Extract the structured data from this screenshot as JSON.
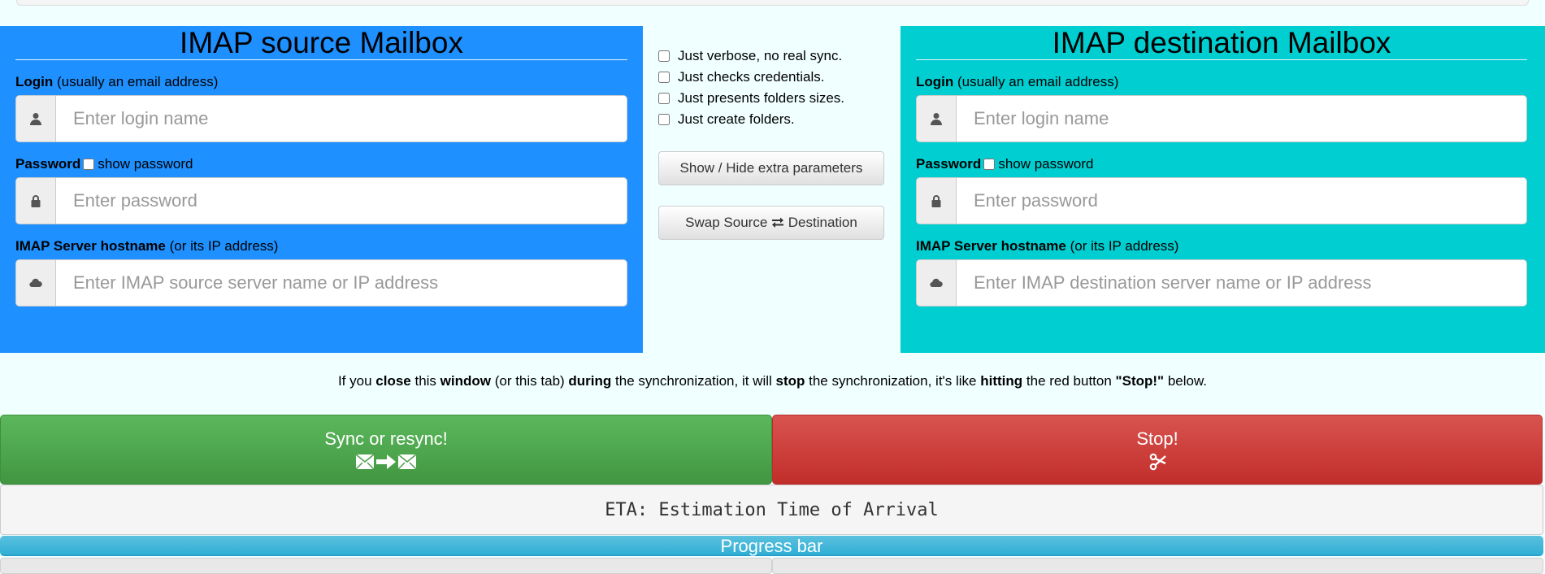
{
  "colors": {
    "background": "#f0ffff",
    "source_box": "#1e90ff",
    "destination_box": "#00ced1",
    "sync_button": "#5cb85c",
    "stop_button": "#d9534f",
    "progress_bar": "#5bc0de"
  },
  "source": {
    "title": "IMAP source Mailbox",
    "login_label_bold": "Login",
    "login_label_hint": "(usually an email address)",
    "login_placeholder": "Enter login name",
    "login_icon": "user-icon",
    "password_label_bold": "Password",
    "show_password_label": "show password",
    "show_password_checked": false,
    "password_placeholder": "Enter password",
    "password_icon": "lock-icon",
    "server_label_bold": "IMAP Server hostname",
    "server_label_hint": "(or its IP address)",
    "server_placeholder": "Enter IMAP source server name or IP address",
    "server_icon": "cloud-icon"
  },
  "destination": {
    "title": "IMAP destination Mailbox",
    "login_label_bold": "Login",
    "login_label_hint": "(usually an email address)",
    "login_placeholder": "Enter login name",
    "login_icon": "user-icon",
    "password_label_bold": "Password",
    "show_password_label": "show password",
    "show_password_checked": false,
    "password_placeholder": "Enter password",
    "password_icon": "lock-icon",
    "server_label_bold": "IMAP Server hostname",
    "server_label_hint": "(or its IP address)",
    "server_placeholder": "Enter IMAP destination server name or IP address",
    "server_icon": "cloud-icon"
  },
  "options": [
    {
      "label": "Just verbose, no real sync.",
      "checked": false
    },
    {
      "label": "Just checks credentials.",
      "checked": false
    },
    {
      "label": "Just presents folders sizes.",
      "checked": false
    },
    {
      "label": "Just create folders.",
      "checked": false
    }
  ],
  "buttons": {
    "show_hide": "Show / Hide extra parameters",
    "swap_prefix": "Swap Source",
    "swap_icon": "swap-arrows-icon",
    "swap_suffix": "Destination",
    "sync": "Sync or resync!",
    "sync_icons": [
      "envelope-icon",
      "arrow-right-icon",
      "envelope-icon"
    ],
    "stop": "Stop!",
    "stop_icon": "scissors-icon"
  },
  "warning": {
    "parts": [
      {
        "text": "If you ",
        "bold": false
      },
      {
        "text": "close",
        "bold": true
      },
      {
        "text": " this ",
        "bold": false
      },
      {
        "text": "window",
        "bold": true
      },
      {
        "text": " (or this tab) ",
        "bold": false
      },
      {
        "text": "during",
        "bold": true
      },
      {
        "text": " the synchronization, it will ",
        "bold": false
      },
      {
        "text": "stop",
        "bold": true
      },
      {
        "text": " the synchronization, it's like ",
        "bold": false
      },
      {
        "text": "hitting",
        "bold": true
      },
      {
        "text": " the red button ",
        "bold": false
      },
      {
        "text": "\"Stop!\"",
        "bold": true
      },
      {
        "text": " below.",
        "bold": false
      }
    ]
  },
  "eta": {
    "text": "ETA: Estimation Time of Arrival"
  },
  "progress": {
    "label": "Progress bar",
    "percent": 100
  }
}
